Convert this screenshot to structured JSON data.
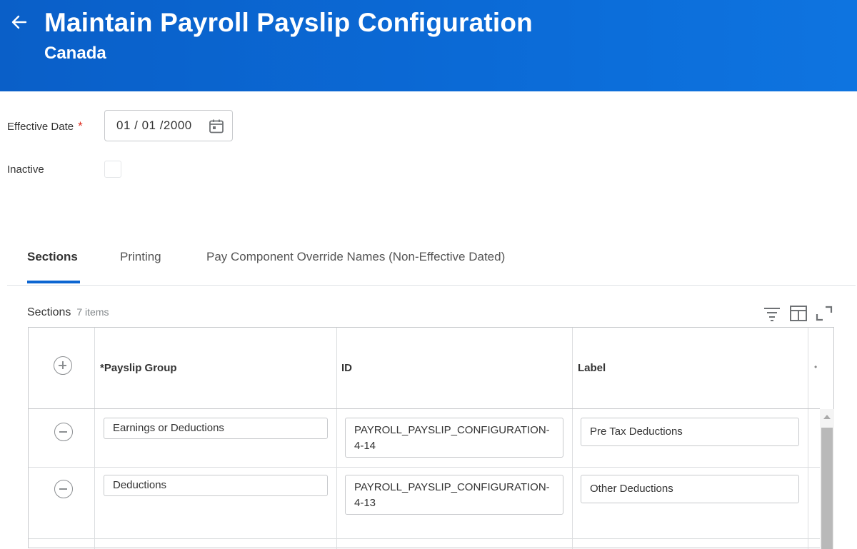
{
  "header": {
    "title": "Maintain Payroll Payslip Configuration",
    "subtitle": "Canada",
    "back_icon": "arrow-left-icon"
  },
  "form": {
    "effective_date": {
      "label": "Effective Date",
      "required_marker": "*",
      "value": "01 / 01 /2000",
      "icon": "calendar-icon"
    },
    "inactive": {
      "label": "Inactive",
      "checked": false
    }
  },
  "tabs": [
    {
      "label": "Sections",
      "active": true
    },
    {
      "label": "Printing",
      "active": false
    },
    {
      "label": "Pay Component Override Names (Non-Effective Dated)",
      "active": false
    }
  ],
  "grid": {
    "title": "Sections",
    "count": "7 items",
    "toolbar_icons": [
      "filter-icon",
      "columns-icon",
      "expand-icon"
    ],
    "columns": [
      "*Payslip Group",
      "ID",
      "Label"
    ],
    "rows": [
      {
        "payslip_group": "Earnings or Deductions",
        "id": "PAYROLL_PAYSLIP_CONFIGURATION-4-14",
        "label": "Pre Tax Deductions"
      },
      {
        "payslip_group": "Deductions",
        "id": "PAYROLL_PAYSLIP_CONFIGURATION-4-13",
        "label": "Other Deductions"
      }
    ]
  },
  "colors": {
    "header_bg": "#0b6ad6",
    "accent": "#0c65d1",
    "required": "#de2e21"
  }
}
